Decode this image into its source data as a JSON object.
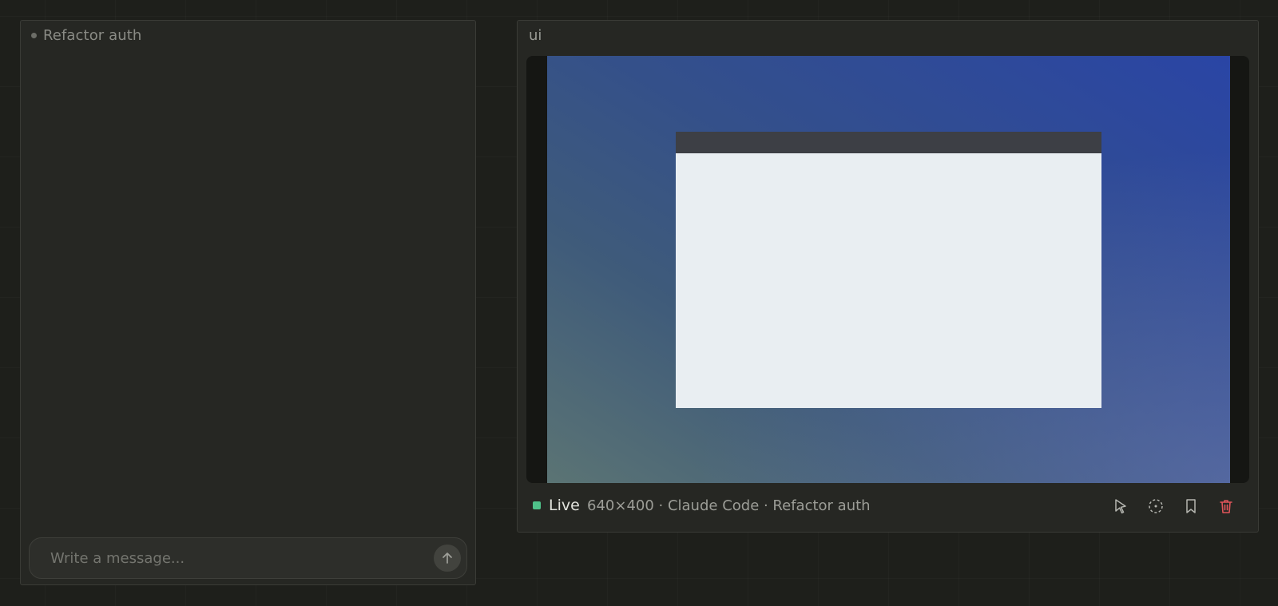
{
  "chat": {
    "title": "Refactor auth",
    "composer_placeholder": "Write a message..."
  },
  "preview": {
    "title": "ui",
    "status_label": "Live",
    "meta": "640×400 · Claude Code · Refactor auth",
    "status_color": "#4fc28a",
    "delete_color": "#e0555a"
  },
  "icons": {
    "send": "arrow-up-icon",
    "select": "cursor-pointer-icon",
    "capture": "dashed-circle-target-icon",
    "bookmark": "bookmark-icon",
    "delete": "trash-icon"
  }
}
